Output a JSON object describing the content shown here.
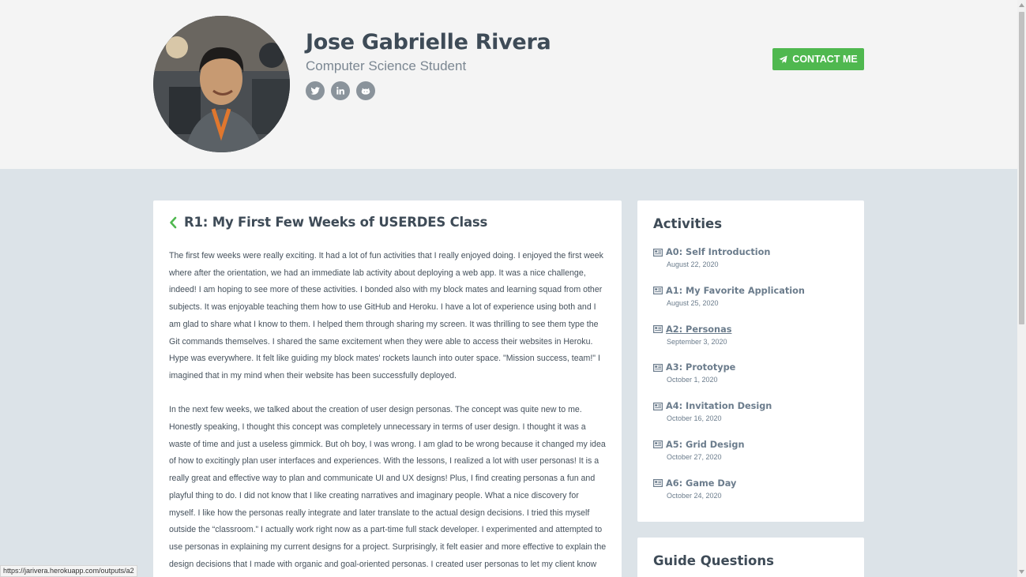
{
  "profile": {
    "name": "Jose Gabrielle Rivera",
    "title": "Computer Science Student",
    "socials": [
      {
        "icon": "twitter-icon"
      },
      {
        "icon": "linkedin-icon"
      },
      {
        "icon": "github-icon"
      }
    ],
    "contact_label": "CONTACT ME"
  },
  "post": {
    "title": "R1: My First Few Weeks of USERDES Class",
    "paragraphs": [
      "The first few weeks were really exciting. It had a lot of fun activities that I really enjoyed doing. I enjoyed the first week where after the orientation, we had an immediate lab activity about deploying a web app. It was a nice challenge, indeed! I am hoping to see more of these activities. I bonded also with my block mates and learning squad from other subjects. It was enjoyable teaching them how to use GitHub and Heroku. I have a lot of experience using both and I am glad to share what I know to them. I helped them through sharing my screen. It was thrilling to see them type the Git commands themselves. I shared the same excitement when they were able to access their websites in Heroku. Hype was everywhere. It felt like guiding my block mates' rockets launch into outer space. \"Mission success, team!\" I imagined that in my mind when their website has been successfully deployed.",
      "In the next few weeks, we talked about the creation of user design personas. The concept was quite new to me. Honestly speaking, I thought this concept was completely unnecessary in terms of user design. I thought it was a waste of time and just a useless gimmick. But oh boy, I was wrong. I am glad to be wrong because it changed my idea of how to excitingly plan user interfaces and experiences. With the lessons, I realized a lot with user personas! It is a really great and effective way to plan and communicate UI and UX designs! Plus, I find creating personas a fun and playful thing to do. I did not know that I like creating narratives and imaginary people. What a nice discovery for myself. I like how the personas really integrate and later translate to the actual design decisions. I tried this myself outside the “classroom.” I actually work right now as a part-time full stack developer. I experimented and attempted to use personas in explaining my current designs for a project. Surprisingly, it felt easier and more effective to explain the design decisions that I made with organic and goal-oriented personas. I created user personas to let my client know"
    ]
  },
  "activities": {
    "heading": "Activities",
    "items": [
      {
        "label": "A0: Self Introduction",
        "date": "August 22, 2020"
      },
      {
        "label": "A1: My Favorite Application",
        "date": "August 25, 2020"
      },
      {
        "label": "A2: Personas",
        "date": "September 3, 2020",
        "hovered": true
      },
      {
        "label": "A3: Prototype",
        "date": "October 1, 2020"
      },
      {
        "label": "A4: Invitation Design",
        "date": "October 16, 2020"
      },
      {
        "label": "A5: Grid Design",
        "date": "October 27, 2020"
      },
      {
        "label": "A6: Game Day",
        "date": "October 24, 2020"
      }
    ]
  },
  "guide": {
    "heading": "Guide Questions"
  },
  "status_bar": {
    "url": "https://jarivera.herokuapp.com/outputs/a2"
  },
  "colors": {
    "accent_green": "#4fb84f",
    "heading": "#3e4b57",
    "link": "#6b7c8c"
  }
}
